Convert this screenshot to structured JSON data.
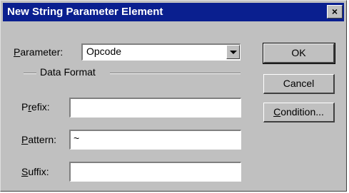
{
  "window": {
    "title": "New String Parameter Element",
    "close_label": "×"
  },
  "parameter": {
    "label_u": "P",
    "label_rest": "arameter:",
    "value": "Opcode"
  },
  "data_format": {
    "group_label": "Data Format",
    "prefix": {
      "label_a": "P",
      "label_u": "r",
      "label_b": "efix:",
      "value": ""
    },
    "pattern": {
      "label_u": "P",
      "label_rest": "attern:",
      "value": "~"
    },
    "suffix": {
      "label_u": "S",
      "label_rest": "uffix:",
      "value": ""
    }
  },
  "buttons": {
    "ok": "OK",
    "cancel": "Cancel",
    "condition_u": "C",
    "condition_rest": "ondition..."
  }
}
